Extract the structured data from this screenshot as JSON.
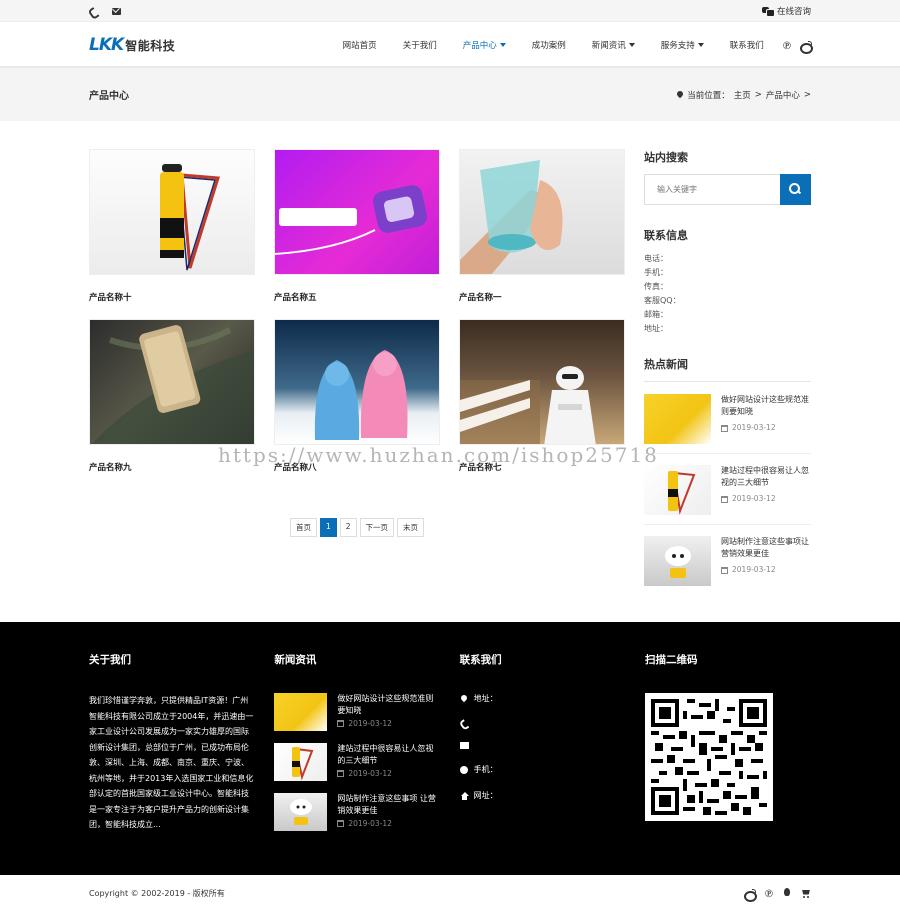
{
  "topbar": {
    "consult_label": "在线咨询"
  },
  "header": {
    "logo_mark": "LKK",
    "logo_text": "智能科技",
    "nav": [
      {
        "label": "网站首页",
        "dropdown": false,
        "active": false
      },
      {
        "label": "关于我们",
        "dropdown": false,
        "active": false
      },
      {
        "label": "产品中心",
        "dropdown": true,
        "active": true
      },
      {
        "label": "成功案例",
        "dropdown": false,
        "active": false
      },
      {
        "label": "新闻资讯",
        "dropdown": true,
        "active": false
      },
      {
        "label": "服务支持",
        "dropdown": true,
        "active": false
      },
      {
        "label": "联系我们",
        "dropdown": false,
        "active": false
      }
    ]
  },
  "banner": {
    "title": "产品中心",
    "crumb_prefix": "当前位置：",
    "crumb_home": "主页",
    "crumb_sep1": " > ",
    "crumb_current": "产品中心",
    "crumb_sep2": " >"
  },
  "products": [
    {
      "name": "产品名称十"
    },
    {
      "name": "产品名称五"
    },
    {
      "name": "产品名称一"
    },
    {
      "name": "产品名称九"
    },
    {
      "name": "产品名称八"
    },
    {
      "name": "产品名称七"
    }
  ],
  "pager": {
    "first": "首页",
    "pages": [
      "1",
      "2"
    ],
    "current": "1",
    "next": "下一页",
    "last": "末页"
  },
  "sidebar": {
    "search_title": "站内搜索",
    "search_placeholder": "输入关键字",
    "contact_title": "联系信息",
    "contact_items": [
      "电话：",
      "手机：",
      "传真：",
      "客服QQ：",
      "邮箱：",
      "地址："
    ],
    "hot_title": "热点新闻",
    "hot_news": [
      {
        "title": "做好网站设计这些规范准则要知晓",
        "date": "2019-03-12"
      },
      {
        "title": "建站过程中很容易让人忽视的三大细节",
        "date": "2019-03-12"
      },
      {
        "title": "网站制作注意这些事项让营销效果更佳",
        "date": "2019-03-12"
      }
    ]
  },
  "footer": {
    "about_title": "关于我们",
    "about_text": "我们珍惜谨学奔敦，只提供精品IT资源！广州智能科技有限公司成立于2004年，并迅速由一家工业设计公司发展成为一家实力雄厚的国际创新设计集团，总部位于广州，已成功布局伦敦、深圳、上海、成都、南京、重庆、宁波、杭州等地，并于2013年入选国家工业和信息化部认定的首批国家级工业设计中心。智能科技是一家专注于为客户提升产品力的创新设计集团，智能科技成立...",
    "news_title": "新闻资讯",
    "news": [
      {
        "title": "做好网站设计这些规范准则要知晓",
        "date": "2019-03-12"
      },
      {
        "title": "建站过程中很容易让人忽视的三大细节",
        "date": "2019-03-12"
      },
      {
        "title": "网站制作注意这些事项 让营销效果更佳",
        "date": "2019-03-12"
      }
    ],
    "contact_title": "联系我们",
    "contact_items": [
      "地址：",
      "",
      "",
      "手机：",
      "网址："
    ],
    "qr_title": "扫描二维码"
  },
  "bottom": {
    "copyright": "Copyright © 2002-2019 - 版权所有"
  },
  "watermark": "https://www.huzhan.com/ishop25718"
}
